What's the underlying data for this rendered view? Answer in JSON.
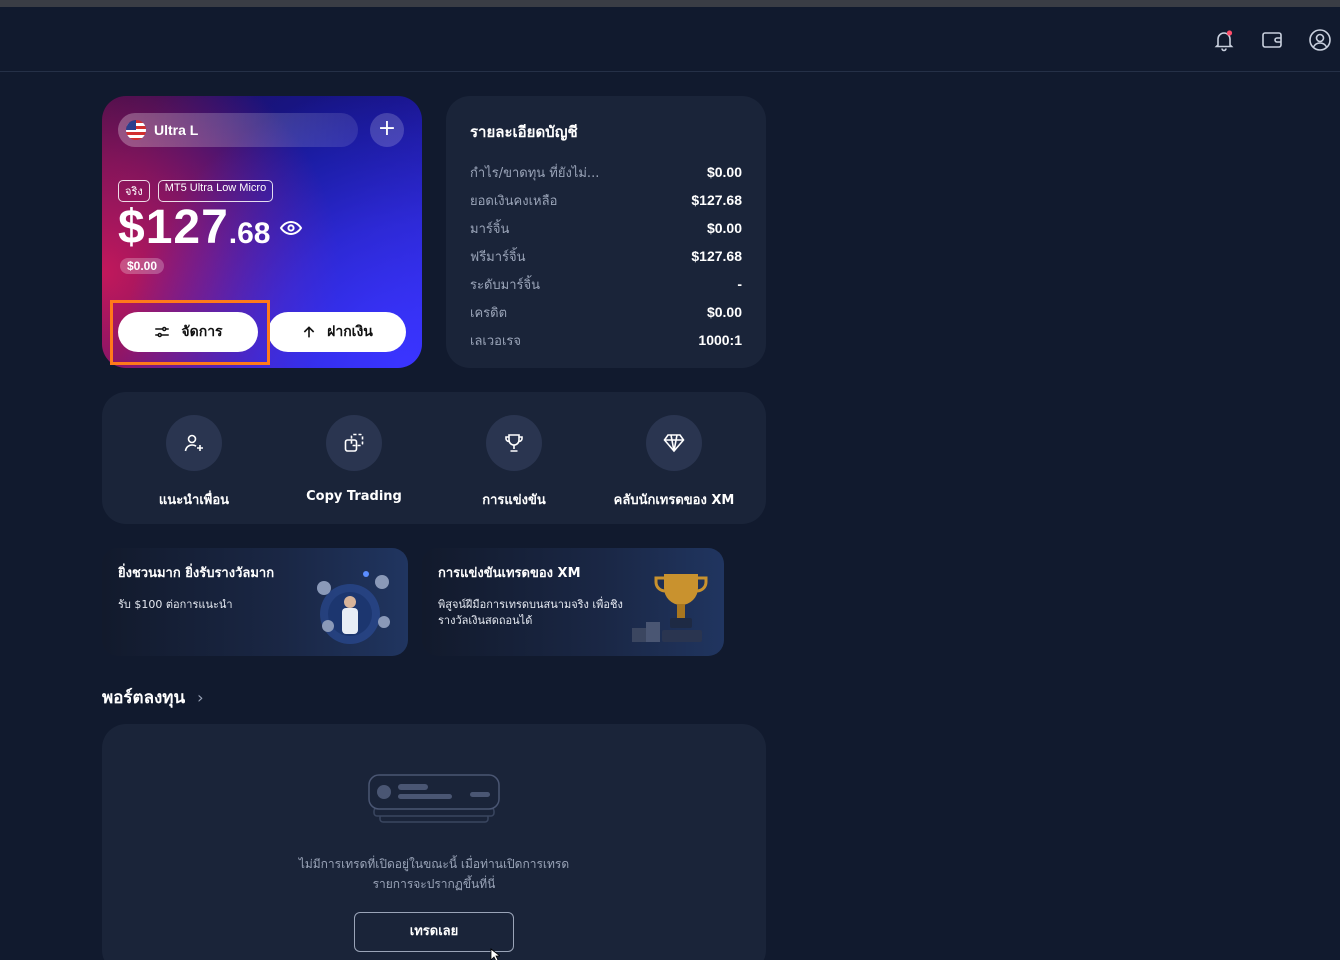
{
  "header": {
    "icons": [
      "bell-icon",
      "wallet-icon",
      "profile-icon"
    ],
    "notification_dot_color": "#ff4d6a"
  },
  "account_card": {
    "name": "Ultra L",
    "tags": [
      "จริง",
      "MT5 Ultra Low Micro"
    ],
    "balance_main": "$127",
    "balance_cents": ".68",
    "sub_balance": "$0.00",
    "manage_label": "จัดการ",
    "deposit_label": "ฝากเงิน"
  },
  "details": {
    "title": "รายละเอียดบัญชี",
    "rows": [
      {
        "label": "กำไร/ขาดทุน ที่ยังไม่...",
        "value": "$0.00"
      },
      {
        "label": "ยอดเงินคงเหลือ",
        "value": "$127.68"
      },
      {
        "label": "มาร์จิ้น",
        "value": "$0.00"
      },
      {
        "label": "ฟรีมาร์จิ้น",
        "value": "$127.68"
      },
      {
        "label": "ระดับมาร์จิ้น",
        "value": "-"
      },
      {
        "label": "เครดิต",
        "value": "$0.00"
      },
      {
        "label": "เลเวอเรจ",
        "value": "1000:1"
      }
    ]
  },
  "quick_actions": [
    {
      "label": "แนะนำเพื่อน",
      "icon": "add-user-icon"
    },
    {
      "label": "Copy Trading",
      "icon": "copy-icon"
    },
    {
      "label": "การแข่งขัน",
      "icon": "trophy-icon"
    },
    {
      "label": "คลับนักเทรดของ XM",
      "icon": "diamond-icon"
    }
  ],
  "promos": [
    {
      "title": "ยิ่งชวนมาก ยิ่งรับรางวัลมาก",
      "text": "รับ $100 ต่อการแนะนำ"
    },
    {
      "title": "การแข่งขันเทรดของ XM",
      "text": "พิสูจน์ฝีมือการเทรดบนสนามจริง เพื่อชิงรางวัลเงินสดถอนได้"
    }
  ],
  "portfolio": {
    "title": "พอร์ตลงทุน",
    "empty_text_line1": "ไม่มีการเทรดที่เปิดอยู่ในขณะนี้ เมื่อท่านเปิดการเทรด",
    "empty_text_line2": "รายการจะปรากฏขึ้นที่นี่",
    "trade_button": "เทรดเลย"
  }
}
